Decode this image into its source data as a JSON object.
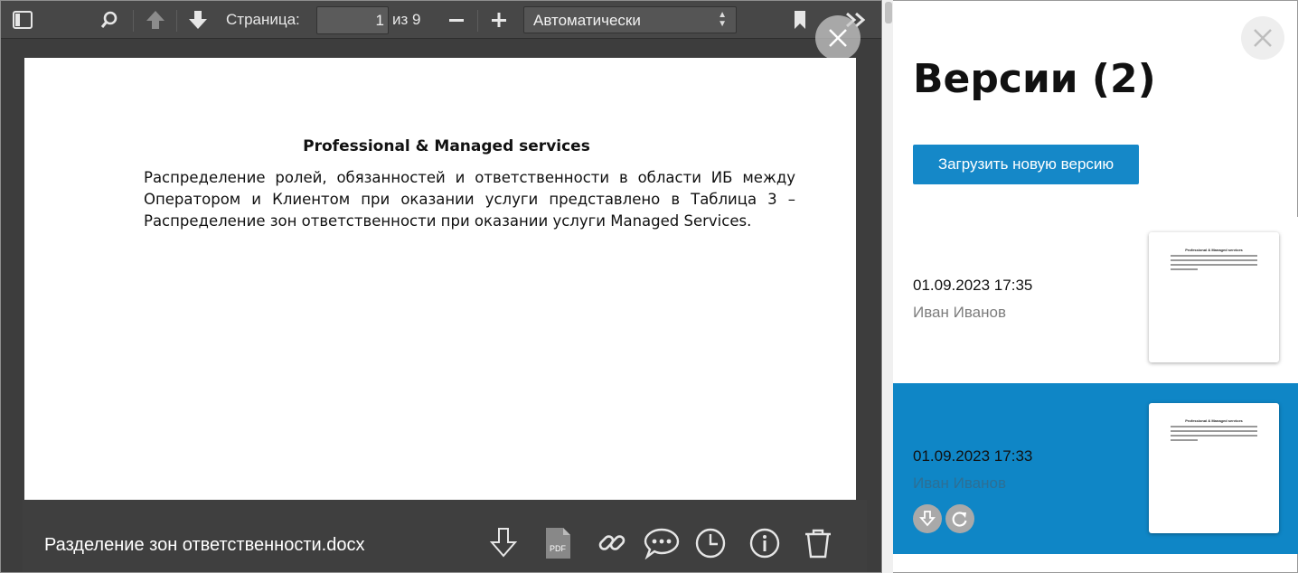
{
  "viewer": {
    "toolbar": {
      "page_label": "Страница:",
      "page_value": "1",
      "page_total": "из 9",
      "zoom_value": "Автоматически",
      "icons": [
        "sidebar-toggle-icon",
        "search-icon",
        "arrow-up-icon",
        "arrow-down-icon",
        "minus-icon",
        "plus-icon",
        "bookmark-icon",
        "double-chevron-right-icon"
      ]
    },
    "document": {
      "title": "Professional & Managed services",
      "body": "Распределение ролей, обязанностей и ответственности в области ИБ между Оператором и Клиентом при оказании услуги представлено в Таблица 3 – Распределение зон ответственности при оказании услуги Managed Services."
    },
    "file_name": "Разделение зон ответственности.docx",
    "pdf_label": "PDF",
    "action_icons": [
      "download-icon",
      "pdf-icon",
      "link-icon",
      "comments-icon",
      "history-icon",
      "info-icon",
      "trash-icon"
    ]
  },
  "panel": {
    "title": "Версии (2)",
    "upload_button": "Загрузить новую версию",
    "versions": [
      {
        "date": "01.09.2023 17:35",
        "author": "Иван Иванов",
        "selected": false
      },
      {
        "date": "01.09.2023 17:33",
        "author": "Иван Иванов",
        "selected": true
      }
    ],
    "thumbnail_title": "Professional & Managed services"
  },
  "colors": {
    "accent": "#1588c8",
    "selected_row": "#0f86c6",
    "viewer_bg": "#3d3d3d",
    "toolbar_bg": "#474747"
  }
}
